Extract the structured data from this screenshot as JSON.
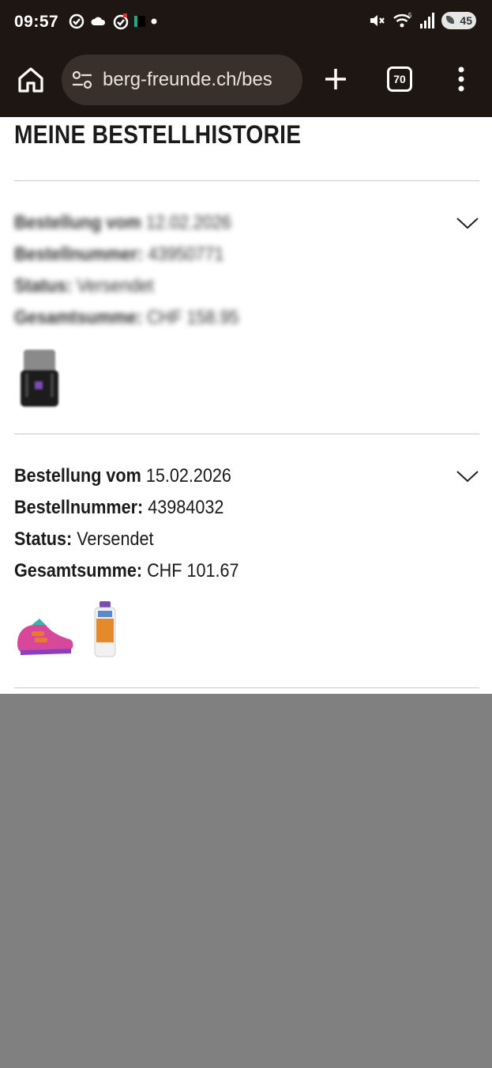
{
  "status_bar": {
    "time": "09:57",
    "battery": "45"
  },
  "browser": {
    "url": "berg-freunde.ch/bes",
    "tab_count": "70"
  },
  "page": {
    "title": "MEINE BESTELLHISTORIE",
    "orders": [
      {
        "label_date": "Bestellung vom",
        "date": "12.02.2026",
        "label_number": "Bestellnummer:",
        "number": "43950771",
        "label_status": "Status:",
        "status": "Versendet",
        "label_total": "Gesamtsumme:",
        "total": "CHF 158.95",
        "items": [
          "backpack"
        ]
      },
      {
        "label_date": "Bestellung vom",
        "date": "15.02.2026",
        "label_number": "Bestellnummer:",
        "number": "43984032",
        "label_status": "Status:",
        "status": "Versendet",
        "label_total": "Gesamtsumme:",
        "total": "CHF 101.67",
        "items": [
          "kids-shoe",
          "wash-bottle"
        ]
      }
    ]
  },
  "colors": {
    "chrome_bg": "#1e1612",
    "url_pill_bg": "#3a302b",
    "overlay_gray": "#808080"
  }
}
